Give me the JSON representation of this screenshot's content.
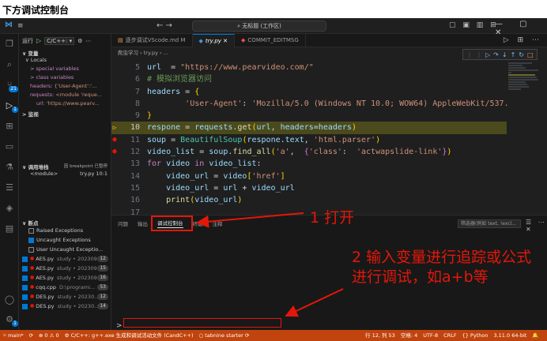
{
  "banner": {
    "title": "下方调试控制台"
  },
  "titlebar": {
    "app_icon": "vscode-icon",
    "menu_label": "≡",
    "nav_label": "←  →",
    "search_text": "⌕ 无标题 (工作区)",
    "layout_icons": "▢ ▣ ▥ ⊞",
    "window_controls": "— ▢ ✕"
  },
  "activity": {
    "items": [
      {
        "name": "files-icon",
        "glyph": "❐"
      },
      {
        "name": "search-icon",
        "glyph": "⌕"
      },
      {
        "name": "source-control-icon",
        "glyph": "⑂",
        "badge": "21"
      },
      {
        "name": "run-debug-icon",
        "glyph": "▷",
        "badge": "1"
      },
      {
        "name": "extensions-icon",
        "glyph": "⊞"
      },
      {
        "name": "remote-icon",
        "glyph": "▭"
      },
      {
        "name": "testing-icon",
        "glyph": "⚗"
      },
      {
        "name": "database-icon",
        "glyph": "☰"
      },
      {
        "name": "layers-icon",
        "glyph": "◈"
      },
      {
        "name": "docker-icon",
        "glyph": "▤"
      }
    ],
    "account_glyph": "◯",
    "settings_glyph": "⚙",
    "settings_badge": "1"
  },
  "sidebar": {
    "run_label": "运行",
    "config_label": "C/C++: ",
    "config_arrow": "▾",
    "variables_header": "∨ 变量",
    "locals_label": "∨ Locals",
    "variables": [
      {
        "level": 2,
        "name": "> special variables",
        "value": ""
      },
      {
        "level": 2,
        "name": "> class variables",
        "value": ""
      },
      {
        "level": 2,
        "name": "headers: ",
        "value": "{'User-Agent':'..."
      },
      {
        "level": 2,
        "name": "requests: ",
        "value": "<module 'reque..."
      },
      {
        "level": 3,
        "name": "url: ",
        "value": "'https://www.pearv..."
      }
    ],
    "watch_header": "> 监视",
    "callstack_header": "∨ 调用堆栈",
    "callstack_status": "因 breakpoint 已暂停",
    "callstack": [
      {
        "frame": "<module>",
        "file": "try.py",
        "pos": "10:1"
      }
    ],
    "breakpoints_header": "∨ 断点",
    "breakpoint_options": [
      {
        "label": "Raised Exceptions",
        "checked": false
      },
      {
        "label": "Uncaught Exceptions",
        "checked": true
      },
      {
        "label": "User Uncaught Exceptio...",
        "checked": false
      }
    ],
    "breakpoint_files": [
      {
        "file": "AES.py",
        "dir": "study • 202309...",
        "count": "12"
      },
      {
        "file": "AES.py",
        "dir": "study • 202309...",
        "count": "15"
      },
      {
        "file": "AES.py",
        "dir": "study • 202309...",
        "count": "16"
      },
      {
        "file": "cqq.cpp",
        "dir": "D:\\programi...",
        "count": "53"
      },
      {
        "file": "DES.py",
        "dir": "study • 20230...",
        "count": "12"
      },
      {
        "file": "DES.py",
        "dir": "study • 20230...",
        "count": "14"
      }
    ]
  },
  "editor": {
    "tabs": [
      {
        "label": "逐步调试VScode.md M",
        "kind": "md",
        "active": false
      },
      {
        "label": "try.py",
        "kind": "py",
        "active": true
      },
      {
        "label": "COMMIT_EDITMSG",
        "kind": "git",
        "active": false
      }
    ],
    "tab_actions": "▷ ⊞ ⋯",
    "breadcrumb": "爬虫学习 › try.py › ...",
    "debug_toolbar": {
      "grip": "⋮⋮",
      "continue": "▷",
      "step_over": "↷",
      "step_into": "↓",
      "step_out": "↑",
      "restart": "↻",
      "stop": "□"
    }
  },
  "code_lines": [
    {
      "n": "5",
      "marker": "",
      "tokens": [
        [
          "v",
          "url"
        ],
        [
          "",
          "  = "
        ],
        [
          "s",
          "\"https://www.pearvideo.com/\""
        ]
      ]
    },
    {
      "n": "6",
      "marker": "",
      "tokens": [
        [
          "c",
          "# 模拟浏览器访问"
        ]
      ]
    },
    {
      "n": "7",
      "marker": "",
      "tokens": [
        [
          "v",
          "headers"
        ],
        [
          "",
          " = "
        ],
        [
          "b1",
          "{"
        ]
      ]
    },
    {
      "n": "8",
      "marker": "",
      "tokens": [
        [
          "",
          "        "
        ],
        [
          "s",
          "'User-Agent'"
        ],
        [
          "",
          ": "
        ],
        [
          "s",
          "'Mozilla/5.0 (Windows NT 10.0; WOW64) AppleWebKit/537."
        ]
      ]
    },
    {
      "n": "9",
      "marker": "",
      "tokens": [
        [
          "b1",
          "}"
        ]
      ]
    },
    {
      "n": "10",
      "marker": "current",
      "tokens": [
        [
          "v",
          "respone"
        ],
        [
          "",
          " = "
        ],
        [
          "v",
          "requests"
        ],
        [
          "",
          "."
        ],
        [
          "f",
          "get"
        ],
        [
          "b1",
          "("
        ],
        [
          "v",
          "url"
        ],
        [
          ", ",
          ""
        ],
        [
          "v",
          "headers"
        ],
        [
          "",
          "="
        ],
        [
          "v",
          "headers"
        ],
        [
          "b1",
          ")"
        ]
      ]
    },
    {
      "n": "11",
      "marker": "bp",
      "tokens": [
        [
          "v",
          "soup"
        ],
        [
          "",
          " = "
        ],
        [
          "cls",
          "BeautifulSoup"
        ],
        [
          "b1",
          "("
        ],
        [
          "v",
          "respone"
        ],
        [
          "",
          "."
        ],
        [
          "v",
          "text"
        ],
        [
          "",
          ", "
        ],
        [
          "s",
          "'html.parser'"
        ],
        [
          "b1",
          ")"
        ]
      ]
    },
    {
      "n": "12",
      "marker": "bp",
      "tokens": [
        [
          "v",
          "video_list"
        ],
        [
          "",
          " = "
        ],
        [
          "v",
          "soup"
        ],
        [
          "",
          "."
        ],
        [
          "f",
          "find_all"
        ],
        [
          "b1",
          "("
        ],
        [
          "s",
          "'a'"
        ],
        [
          "",
          ",  "
        ],
        [
          "b2",
          "{"
        ],
        [
          "s",
          "'class'"
        ],
        [
          "",
          ":  "
        ],
        [
          "s",
          "'actwapslide-link'"
        ],
        [
          "b2",
          "}"
        ],
        [
          "b1",
          ")"
        ]
      ]
    },
    {
      "n": "13",
      "marker": "",
      "tokens": [
        [
          "k",
          "for"
        ],
        [
          "",
          " "
        ],
        [
          "v",
          "video"
        ],
        [
          "",
          " "
        ],
        [
          "k",
          "in"
        ],
        [
          "",
          " "
        ],
        [
          "v",
          "video_list"
        ],
        [
          "",
          ":"
        ]
      ]
    },
    {
      "n": "14",
      "marker": "",
      "tokens": [
        [
          "",
          "    "
        ],
        [
          "v",
          "video_url"
        ],
        [
          "",
          " = "
        ],
        [
          "v",
          "video"
        ],
        [
          "b1",
          "["
        ],
        [
          "s",
          "'href'"
        ],
        [
          "b1",
          "]"
        ]
      ]
    },
    {
      "n": "15",
      "marker": "",
      "tokens": [
        [
          "",
          "    "
        ],
        [
          "v",
          "video_url"
        ],
        [
          "",
          " = "
        ],
        [
          "v",
          "url"
        ],
        [
          "",
          " + "
        ],
        [
          "v",
          "video_url"
        ]
      ]
    },
    {
      "n": "16",
      "marker": "",
      "tokens": [
        [
          "",
          "    "
        ],
        [
          "f",
          "print"
        ],
        [
          "b1",
          "("
        ],
        [
          "v",
          "video_url"
        ],
        [
          "b1",
          ")"
        ]
      ]
    },
    {
      "n": "17",
      "marker": "",
      "tokens": []
    }
  ],
  "panel": {
    "tabs": [
      {
        "label": "问题",
        "active": false
      },
      {
        "label": "输出",
        "active": false
      },
      {
        "label": "调试控制台",
        "active": true
      },
      {
        "label": "终端",
        "active": false
      },
      {
        "label": "注释",
        "active": false
      }
    ],
    "filter_placeholder": "筛选器(例如 text, !excl...",
    "panel_controls": "☰ ⋯ ✕",
    "prompt": ">"
  },
  "statusbar": {
    "left": [
      {
        "name": "branch",
        "text": "⑂ main*"
      },
      {
        "name": "sync",
        "text": "⟳"
      },
      {
        "name": "problems",
        "text": "⊗ 0 ⚠ 0"
      },
      {
        "name": "debug-config",
        "text": "⚙ C/C++: g++.exe 生成和调试活动文件 (CandC++)"
      },
      {
        "name": "tabnine",
        "text": "○ tabnine starter ⟳"
      }
    ],
    "right": [
      {
        "name": "cursor-pos",
        "text": "行 12, 列 53"
      },
      {
        "name": "indent",
        "text": "空格: 4"
      },
      {
        "name": "encoding",
        "text": "UTF-8"
      },
      {
        "name": "eol",
        "text": "CRLF"
      },
      {
        "name": "language",
        "text": "{} Python"
      },
      {
        "name": "interpreter",
        "text": "3.11.0 64-bit"
      },
      {
        "name": "notifications",
        "text": "🔔"
      }
    ]
  },
  "annotations": {
    "note1": "1 打开",
    "note2": "2 输入变量进行追踪或公式进行调试，如a+b等",
    "accent": "#e3170a"
  },
  "colors": {
    "statusbar": "#c1440e",
    "current_line": "#4b4a1c",
    "breakpoint": "#e51400"
  }
}
